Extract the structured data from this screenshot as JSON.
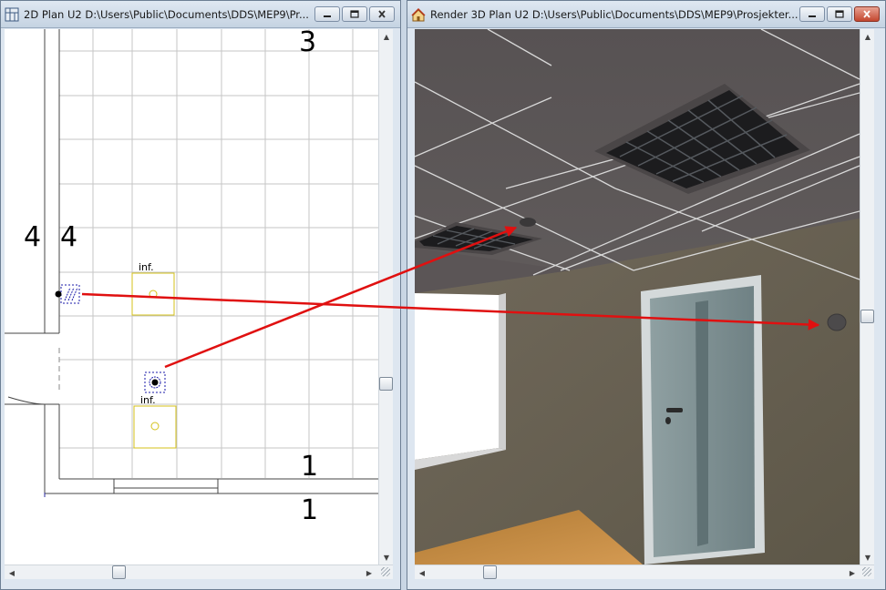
{
  "window_2d": {
    "title": "2D  Plan U2  D:\\Users\\Public\\Documents\\DDS\\MEP9\\Pr...",
    "plan_numbers": {
      "top": "3",
      "left_a": "4",
      "left_b": "4",
      "bottom_a": "1",
      "bottom_b": "1"
    },
    "inf_labels": {
      "upper": "inf.",
      "lower": "inf."
    }
  },
  "window_3d": {
    "title": "Render  3D  Plan U2  D:\\Users\\Public\\Documents\\DDS\\MEP9\\Prosjekter..."
  },
  "colors": {
    "annotation_arrow": "#e01010",
    "selection_box": "#1a1aa8",
    "grid_line": "#c6c6c6",
    "inf_box": "#d4c21a",
    "ceiling": "#5f5a59",
    "wall": "#6f6759",
    "floor": "#c58a3e",
    "door": "#7e8f92"
  }
}
